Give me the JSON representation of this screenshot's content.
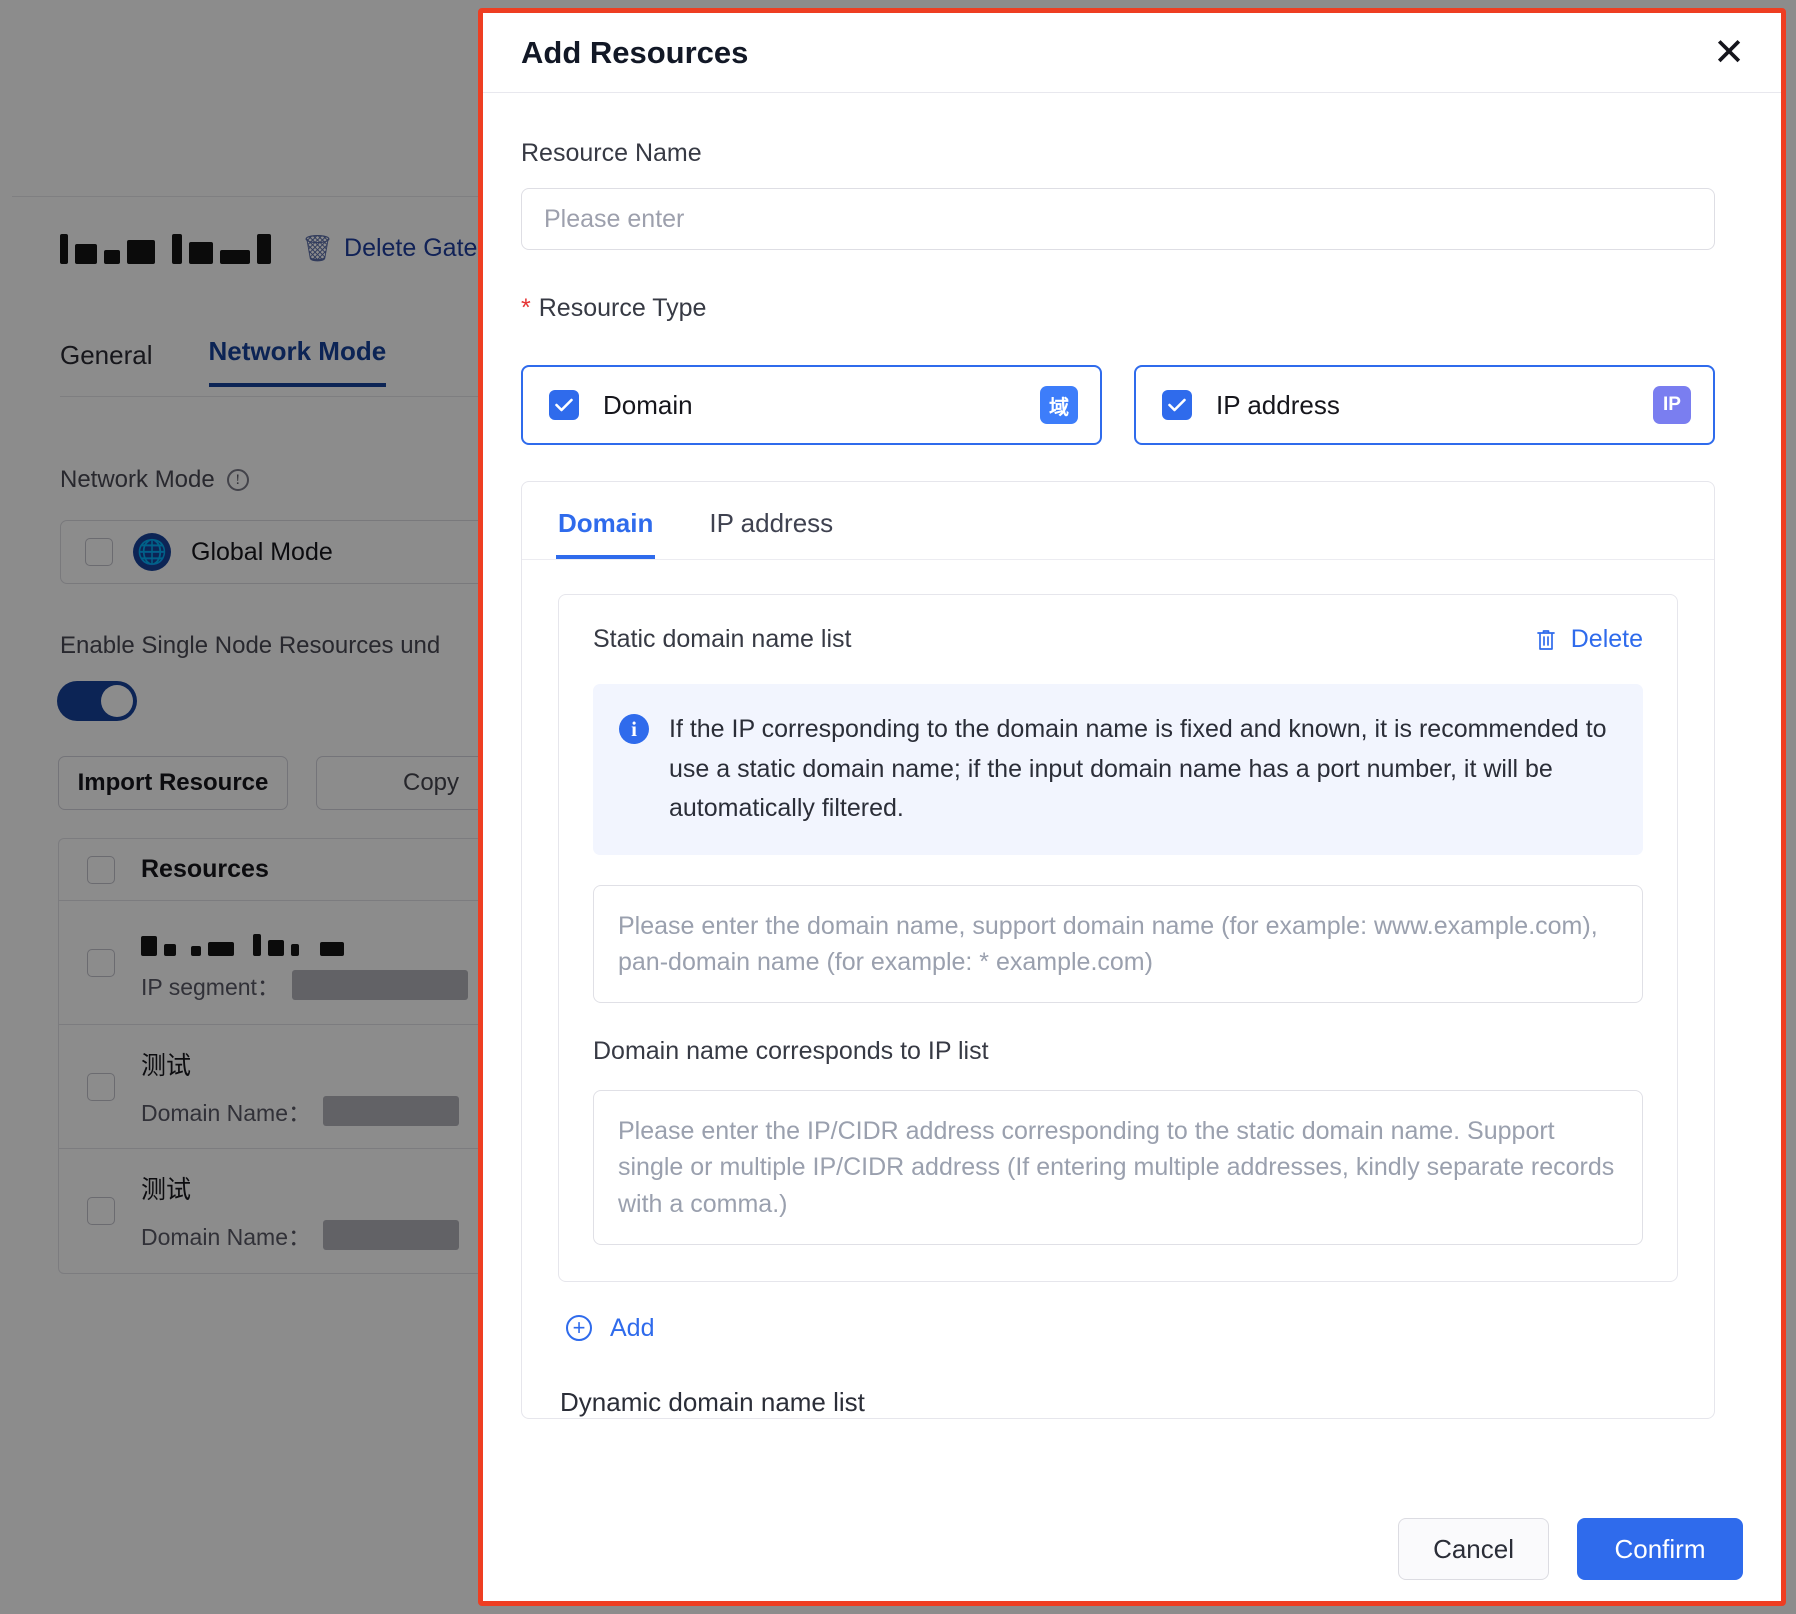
{
  "background": {
    "delete_gateway_label": "Delete Gate",
    "tabs": [
      {
        "label": "General",
        "active": false
      },
      {
        "label": "Network Mode",
        "active": true
      }
    ],
    "network_mode_label": "Network Mode",
    "global_mode_label": "Global Mode",
    "enable_single_node_label": "Enable Single Node Resources und",
    "buttons": {
      "import_resource": "Import Resource",
      "copy": "Copy"
    },
    "table": {
      "header": "Resources",
      "rows": [
        {
          "title": "",
          "field_label": "IP segment：",
          "redacted": true
        },
        {
          "title": "测试",
          "field_label": "Domain Name：",
          "redacted": true
        },
        {
          "title": "测试",
          "field_label": "Domain Name：",
          "redacted": true
        }
      ]
    }
  },
  "modal": {
    "title": "Add Resources",
    "close_icon": "close-icon",
    "resource_name": {
      "label": "Resource Name",
      "value": "",
      "placeholder": "Please enter"
    },
    "resource_type": {
      "label": "Resource Type",
      "required_marker": "*",
      "options": [
        {
          "label": "Domain",
          "badge": "域",
          "badge_color": "#3d7dfa",
          "checked": true
        },
        {
          "label": "IP address",
          "badge": "IP",
          "badge_color": "#7a7ef0",
          "checked": true
        }
      ]
    },
    "panel": {
      "tabs": [
        {
          "label": "Domain",
          "active": true
        },
        {
          "label": "IP address",
          "active": false
        }
      ],
      "static_list": {
        "title": "Static domain name list",
        "delete_label": "Delete",
        "delete_icon": "trash-icon",
        "alert_icon": "info-icon",
        "alert_text": "If the IP corresponding to the domain name is fixed and known, it is recommended to use a static domain name; if the input domain name has a port number, it will be automatically filtered.",
        "domain_input": {
          "value": "",
          "placeholder": "Please enter the domain name, support domain name (for example: www.example.com), pan-domain name (for example: * example.com)"
        },
        "ip_list": {
          "label": "Domain name corresponds to IP list",
          "value": "",
          "placeholder": "Please enter the IP/CIDR address corresponding to the static domain name. Support single or multiple IP/CIDR address (If entering multiple addresses, kindly separate records with a comma.)"
        }
      },
      "add_label": "Add",
      "add_icon": "plus-circle-icon",
      "dynamic_list_title": "Dynamic domain name list"
    },
    "footer": {
      "cancel_label": "Cancel",
      "confirm_label": "Confirm"
    },
    "accent_color": "#2f6bec",
    "highlight_border_color": "#ee3e22"
  }
}
